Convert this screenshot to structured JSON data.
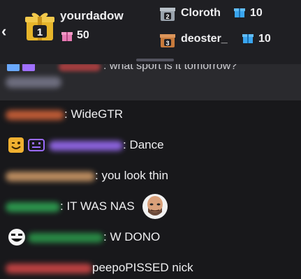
{
  "header": {
    "back_glyph": "‹",
    "top_gifter": {
      "rank": "1",
      "name": "yourdadow",
      "count": "50"
    },
    "ranked": [
      {
        "rank": "2",
        "name": "Cloroth",
        "count": "10"
      },
      {
        "rank": "3",
        "name": "deoster_",
        "count": "10"
      }
    ]
  },
  "pinned": {
    "text": ": what sport is it tomorrow?"
  },
  "messages": [
    {
      "text": ": WideGTR"
    },
    {
      "text": ": Dance"
    },
    {
      "text": ": you look thin"
    },
    {
      "text": ": IT WAS NAS"
    },
    {
      "text": ": W DONO"
    },
    {
      "text": " peepoPISSED nick"
    }
  ],
  "colors": {
    "gold": "#e7b52a",
    "silver": "#9aa3ad",
    "bronze": "#c77a3c",
    "gift_blue": "#3aa6f0",
    "gift_pink": "#e77bb4"
  }
}
